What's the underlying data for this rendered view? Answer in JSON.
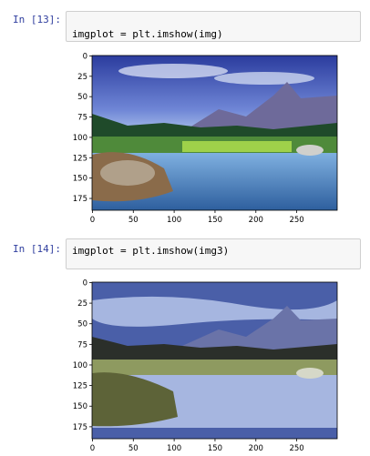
{
  "cells": [
    {
      "prompt": "In [13]:",
      "code": "imgplot = plt.imshow(img)",
      "chart_data": {
        "type": "image",
        "title": "",
        "xlabel": "",
        "ylabel": "",
        "x_ticks": [
          0,
          50,
          100,
          150,
          200,
          250
        ],
        "y_ticks": [
          0,
          25,
          50,
          75,
          100,
          125,
          150,
          175
        ],
        "xlim": [
          -0.5,
          299.5
        ],
        "ylim": [
          189.5,
          -0.5
        ],
        "grid": false,
        "content": "full-color mountain lake landscape"
      }
    },
    {
      "prompt": "In [14]:",
      "code": "imgplot = plt.imshow(img3)",
      "chart_data": {
        "type": "image",
        "title": "",
        "xlabel": "",
        "ylabel": "",
        "x_ticks": [
          0,
          50,
          100,
          150,
          200,
          250
        ],
        "y_ticks": [
          0,
          25,
          50,
          75,
          100,
          125,
          150,
          175
        ],
        "xlim": [
          -0.5,
          299.5
        ],
        "ylim": [
          189.5,
          -0.5
        ],
        "grid": false,
        "content": "color-quantized mountain lake landscape"
      }
    }
  ],
  "colors": {
    "prompt": "#303f9f",
    "input_bg": "#f7f7f7",
    "input_border": "#cfcfcf"
  }
}
